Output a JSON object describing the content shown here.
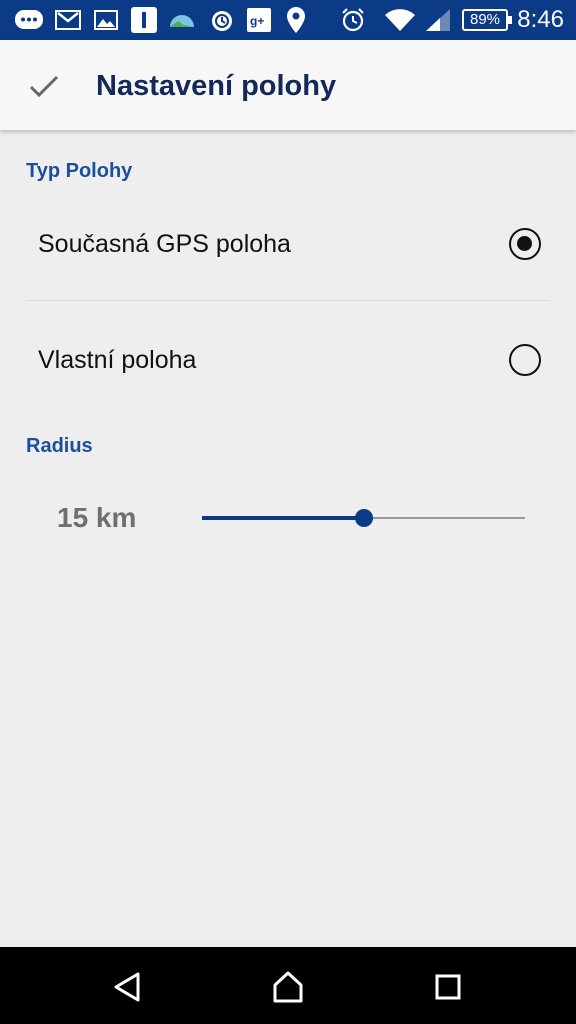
{
  "status_bar": {
    "time": "8:46",
    "battery": "89%",
    "icons": [
      "messages-icon",
      "gmail-icon",
      "gallery-icon",
      "notification-icon",
      "weather-icon",
      "alarm-app-icon",
      "google-plus-icon",
      "location-icon",
      "alarm-clock-icon",
      "wifi-icon",
      "signal-icon"
    ]
  },
  "toolbar": {
    "title": "Nastavení polohy",
    "confirm_icon": "check-icon"
  },
  "location_type": {
    "header": "Typ Polohy",
    "options": [
      {
        "label": "Současná GPS poloha",
        "selected": true
      },
      {
        "label": "Vlastní poloha",
        "selected": false
      }
    ]
  },
  "radius": {
    "header": "Radius",
    "value_label": "15 km",
    "slider_fraction": 0.5
  },
  "nav_bar": {
    "icons": [
      "back-icon",
      "home-icon",
      "recents-icon"
    ]
  },
  "colors": {
    "accent": "#0b3a86",
    "section_header": "#1a4f9c",
    "title": "#14285a"
  }
}
